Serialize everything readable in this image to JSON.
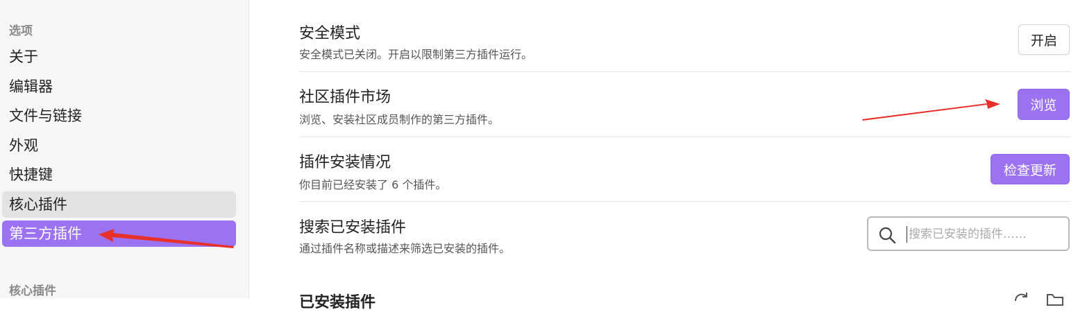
{
  "sidebar": {
    "section_options": "选项",
    "items": [
      {
        "label": "关于"
      },
      {
        "label": "编辑器"
      },
      {
        "label": "文件与链接"
      },
      {
        "label": "外观"
      },
      {
        "label": "快捷键"
      },
      {
        "label": "核心插件"
      },
      {
        "label": "第三方插件"
      }
    ],
    "section_core_plugins": "核心插件"
  },
  "main": {
    "safe_mode": {
      "title": "安全模式",
      "desc": "安全模式已关闭。开启以限制第三方插件运行。",
      "button": "开启"
    },
    "community": {
      "title": "社区插件市场",
      "desc": "浏览、安装社区成员制作的第三方插件。",
      "button": "浏览"
    },
    "installed_status": {
      "title": "插件安装情况",
      "desc": "你目前已经安装了 6 个插件。",
      "button": "检查更新"
    },
    "search": {
      "title": "搜索已安装插件",
      "desc": "通过插件名称或描述来筛选已安装的插件。",
      "placeholder": "搜索已安装的插件……"
    },
    "installed_heading": "已安装插件"
  },
  "colors": {
    "accent": "#9b73f2",
    "annotation_arrow": "#e8302a",
    "sidebar_bg": "#f6f6f6"
  },
  "icons": {
    "search": "search-icon",
    "reload": "reload-icon",
    "folder": "folder-icon"
  }
}
